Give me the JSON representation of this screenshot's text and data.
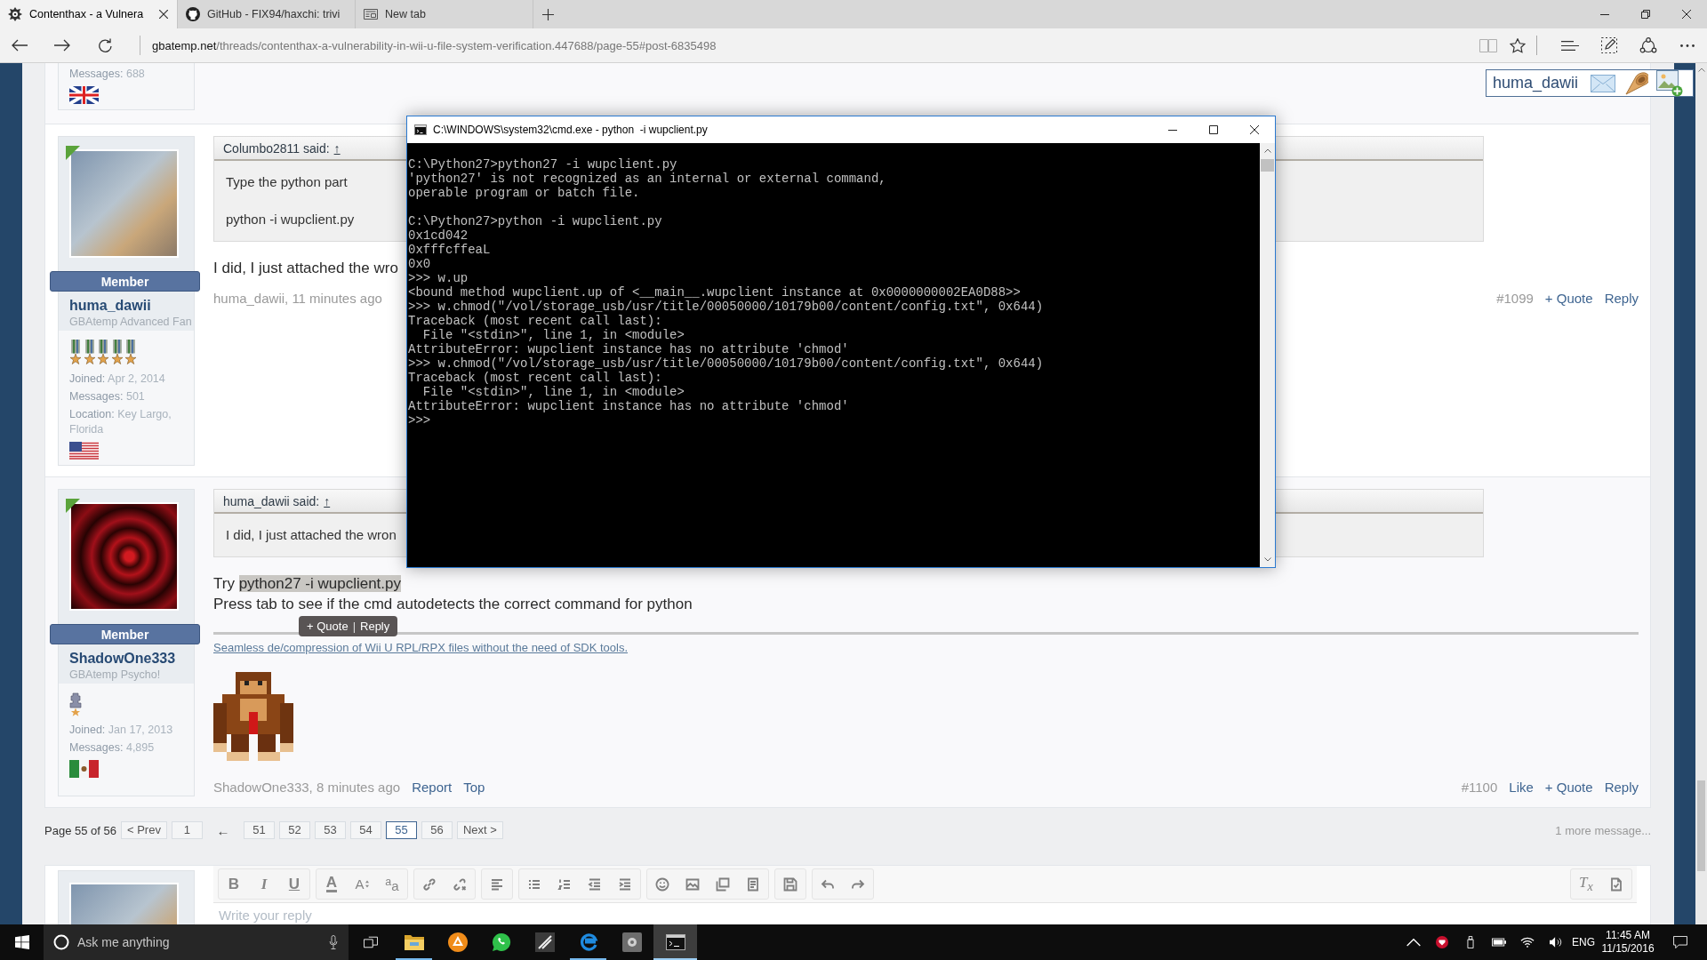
{
  "browser": {
    "tabs": [
      {
        "title": "Contenthax - a Vulnera",
        "kind": "site",
        "selected": true
      },
      {
        "title": "GitHub - FIX94/haxchi: trivi",
        "kind": "github",
        "selected": false
      },
      {
        "title": "New tab",
        "kind": "blank",
        "selected": false
      }
    ],
    "address": {
      "domain": "gbatemp.net",
      "path": "/threads/contenthax-a-vulnerability-in-wii-u-file-system-verification.447688/page-55#post-6835498"
    }
  },
  "user_nav": {
    "username": "huma_dawii"
  },
  "previous_post": {
    "info": [
      {
        "label": "Messages:",
        "value": "688"
      }
    ],
    "flag": {
      "kind": "uk"
    }
  },
  "posts": [
    {
      "avatar": {
        "kind": "photo"
      },
      "online": true,
      "rank": "Member",
      "username": "huma_dawii",
      "title": "GBAtemp Advanced Fan",
      "awards": [
        {
          "kind": "medal"
        },
        {
          "kind": "medal"
        },
        {
          "kind": "medal"
        },
        {
          "kind": "medal"
        },
        {
          "kind": "medal"
        }
      ],
      "info": [
        {
          "label": "Joined:",
          "value": "Apr 2, 2014"
        },
        {
          "label": "Messages:",
          "value": "501"
        },
        {
          "label": "Location:",
          "value": "Key Largo, Florida"
        }
      ],
      "flag": {
        "kind": "us"
      },
      "quote": {
        "author": "Columbo2811 said:",
        "link": "↑",
        "lines": [
          "Type the python part",
          "python -i wupclient.py"
        ]
      },
      "message": [
        {
          "segments": [
            {
              "text": "I did, I just attached the wro",
              "selected": false
            }
          ]
        }
      ],
      "footer": {
        "byline": "huma_dawii, 11 minutes ago",
        "number": "#1099",
        "links_right": [
          "+ Quote",
          "Reply"
        ]
      }
    },
    {
      "avatar": {
        "kind": "swirl"
      },
      "online": true,
      "rank": "Member",
      "username": "ShadowOne333",
      "title": "GBAtemp Psycho!",
      "awards": [
        {
          "kind": "figure"
        }
      ],
      "info": [
        {
          "label": "Joined:",
          "value": "Jan 17, 2013"
        },
        {
          "label": "Messages:",
          "value": "4,895"
        }
      ],
      "flag": {
        "kind": "mx"
      },
      "quote": {
        "author": "huma_dawii said:",
        "link": "↑",
        "lines": [
          "I did, I just attached the wron"
        ]
      },
      "message": [
        {
          "segments": [
            {
              "text": "Try ",
              "selected": false
            },
            {
              "text": "python27 -i wupclient.py",
              "selected": true
            }
          ]
        },
        {
          "segments": [
            {
              "text": "Press tab to see if the cmd autodetects the correct command for python",
              "selected": false
            }
          ]
        }
      ],
      "selection_tooltip": {
        "actions": [
          "+ Quote",
          "Reply"
        ],
        "separator": "|"
      },
      "signature": {
        "link": "Seamless de/compression of Wii U RPL/RPX files without the need of SDK tools.",
        "image": {
          "kind": "sprite"
        }
      },
      "footer": {
        "byline": "ShadowOne333, 8 minutes ago",
        "links_left": [
          "Report",
          "Top"
        ],
        "number": "#1100",
        "links_right": [
          "Like",
          "+ Quote",
          "Reply"
        ]
      }
    }
  ],
  "pagination": {
    "summary": "Page 55 of 56",
    "items": [
      {
        "label": "< Prev",
        "kind": "page",
        "selected": false
      },
      {
        "label": "1",
        "kind": "page",
        "selected": false
      },
      {
        "label": "←",
        "kind": "gap",
        "selected": false
      },
      {
        "label": "51",
        "kind": "page",
        "selected": false
      },
      {
        "label": "52",
        "kind": "page",
        "selected": false
      },
      {
        "label": "53",
        "kind": "page",
        "selected": false
      },
      {
        "label": "54",
        "kind": "page",
        "selected": false
      },
      {
        "label": "55",
        "kind": "page",
        "selected": true
      },
      {
        "label": "56",
        "kind": "page",
        "selected": false
      },
      {
        "label": "Next >",
        "kind": "page",
        "selected": false
      }
    ],
    "more": "1 more message..."
  },
  "reply_editor": {
    "toolbar": [
      [
        {
          "kind": "bold",
          "label": "B"
        },
        {
          "kind": "italic",
          "label": "I"
        },
        {
          "kind": "underline",
          "label": "U"
        }
      ],
      [
        {
          "kind": "color",
          "label": "A"
        },
        {
          "kind": "size",
          "label": "A"
        },
        {
          "kind": "font",
          "label": "$^{a}$a"
        }
      ],
      [
        {
          "kind": "link"
        },
        {
          "kind": "unlink"
        }
      ],
      [
        {
          "kind": "align"
        }
      ],
      [
        {
          "kind": "bullets"
        },
        {
          "kind": "numbers"
        },
        {
          "kind": "outdent"
        },
        {
          "kind": "indent"
        }
      ],
      [
        {
          "kind": "smiley"
        },
        {
          "kind": "image"
        },
        {
          "kind": "media"
        },
        {
          "kind": "document"
        }
      ],
      [
        {
          "kind": "save"
        }
      ],
      [
        {
          "kind": "undo"
        },
        {
          "kind": "redo"
        }
      ]
    ],
    "toolbar_right": [
      {
        "kind": "clear",
        "label": "T$_{x}$"
      },
      {
        "kind": "page"
      }
    ],
    "placeholder": "Write your reply"
  },
  "console_window": {
    "title": "C:\\WINDOWS\\system32\\cmd.exe - python  -i wupclient.py",
    "blocks": [
      [
        "C:\\Python27>python27 -i wupclient.py",
        "'python27' is not recognized as an internal or external command,",
        "operable program or batch file."
      ],
      [
        "C:\\Python27>python -i wupclient.py",
        "0x1cd042",
        "0xfffcffeaL",
        "0x0",
        ">>> w.up",
        "<bound method wupclient.up of <__main__.wupclient instance at 0x0000000002EA0D88>>",
        ">>> w.chmod(\"/vol/storage_usb/usr/title/00050000/10179b00/content/config.txt\", 0x644)",
        "Traceback (most recent call last):",
        "  File \"<stdin>\", line 1, in <module>",
        "AttributeError: wupclient instance has no attribute 'chmod'",
        ">>> w.chmod(\"/vol/storage_usb/usr/title/00050000/10179b00/content/config.txt\", 0x644)",
        "Traceback (most recent call last):",
        "  File \"<stdin>\", line 1, in <module>",
        "AttributeError: wupclient instance has no attribute 'chmod'",
        ">>>"
      ]
    ]
  },
  "taskbar": {
    "search": {
      "placeholder": "Ask me anything"
    },
    "apps": [
      {
        "kind": "explorer",
        "running": true,
        "selected": false
      },
      {
        "kind": "triangle",
        "running": false,
        "selected": false
      },
      {
        "kind": "chat",
        "running": false,
        "selected": false
      },
      {
        "kind": "tile",
        "running": false,
        "selected": false
      },
      {
        "kind": "edge",
        "running": true,
        "selected": false
      },
      {
        "kind": "gear",
        "running": false,
        "selected": false
      },
      {
        "kind": "terminal",
        "running": true,
        "selected": true
      }
    ],
    "tray": {
      "language": "ENG",
      "time": "11:45 AM",
      "date": "11/15/2016"
    }
  }
}
